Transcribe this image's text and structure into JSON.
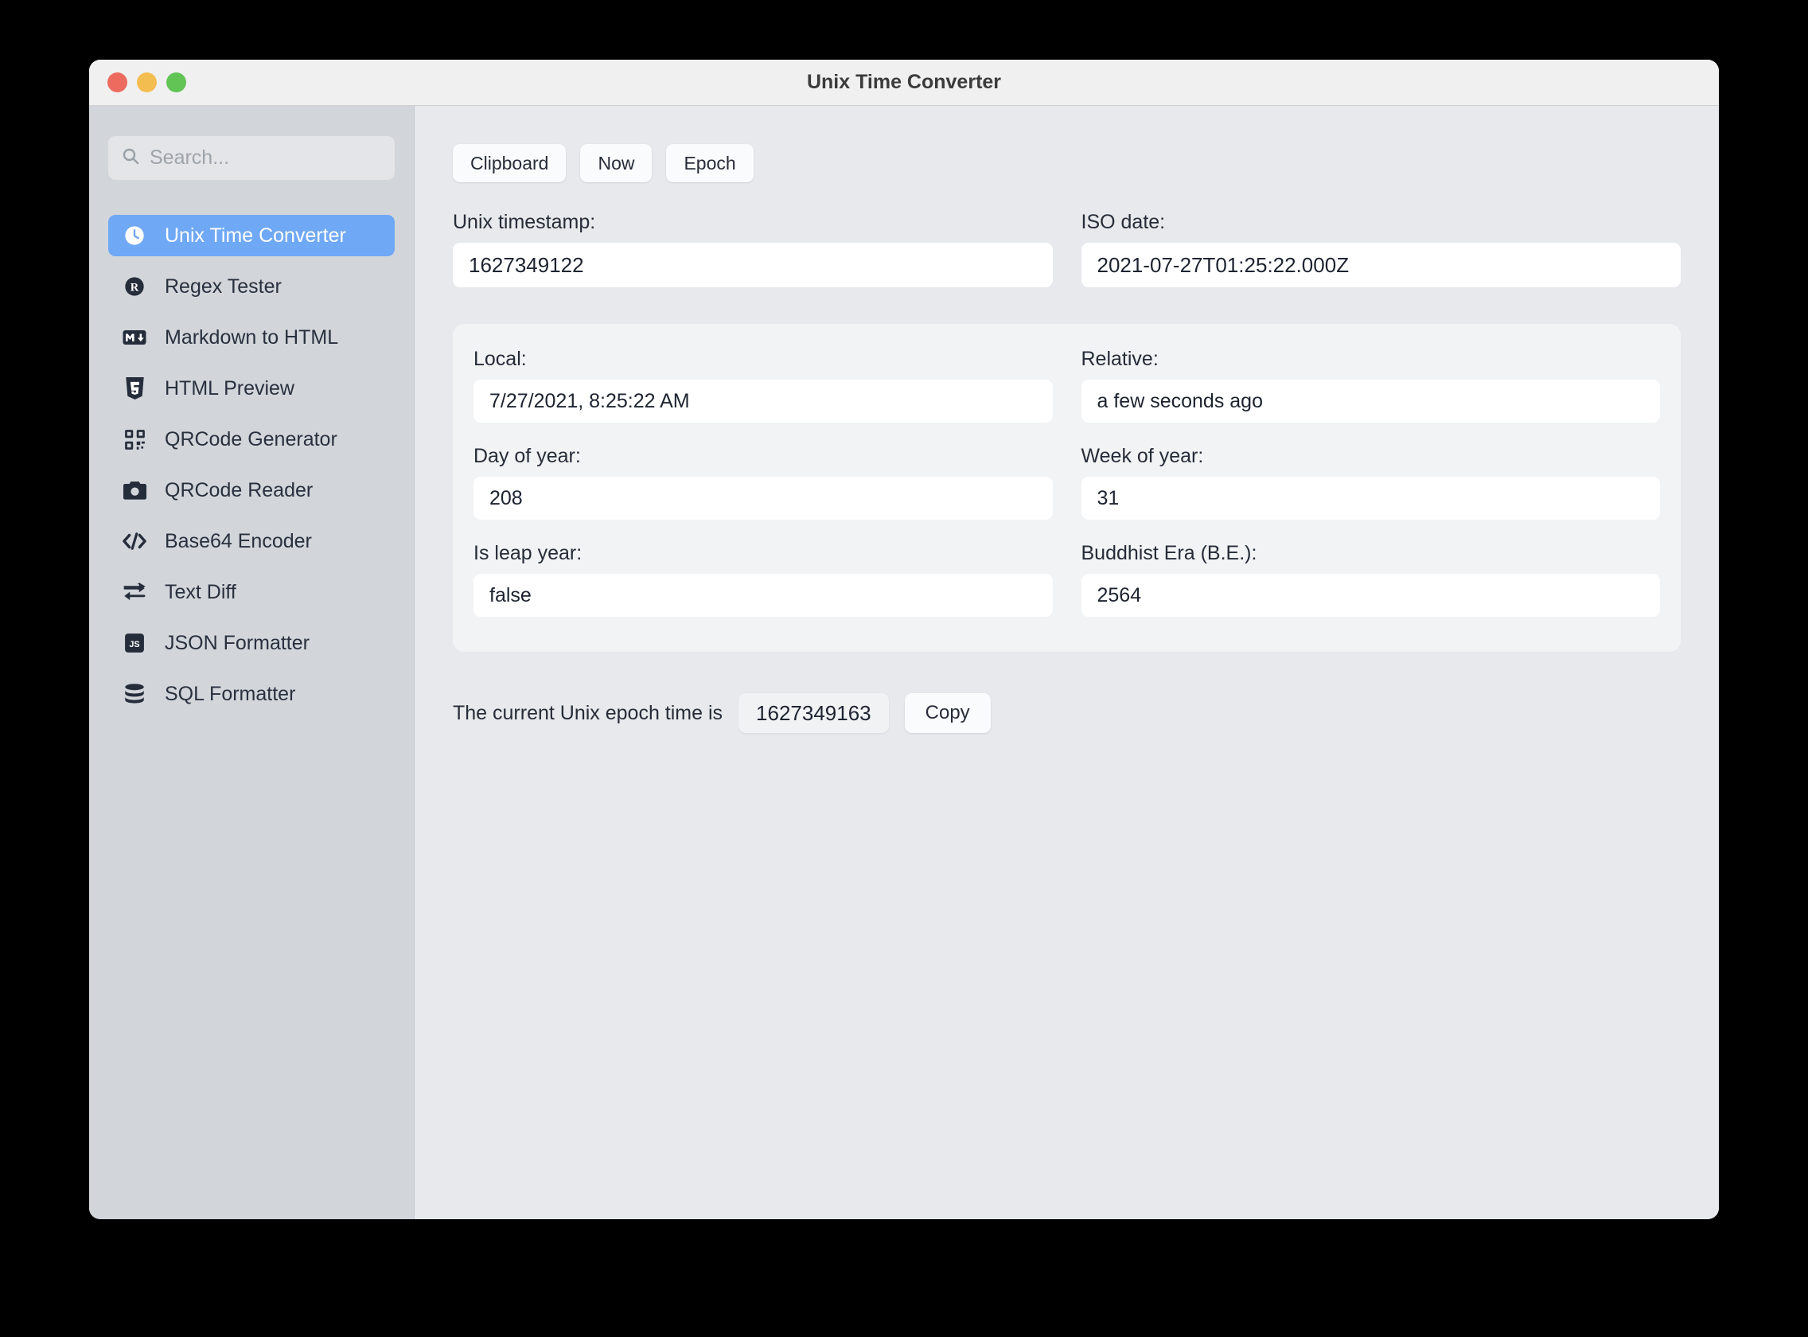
{
  "window": {
    "title": "Unix Time Converter",
    "traffic_lights": [
      {
        "name": "close",
        "color": "#ed6a5f"
      },
      {
        "name": "minimize",
        "color": "#f4bd50"
      },
      {
        "name": "maximize",
        "color": "#61c454"
      }
    ]
  },
  "sidebar": {
    "search": {
      "placeholder": "Search...",
      "value": "",
      "icon": "search-icon"
    },
    "items": [
      {
        "label": "Unix Time Converter",
        "icon": "clock-icon",
        "active": true
      },
      {
        "label": "Regex Tester",
        "icon": "regex-circle-icon",
        "active": false
      },
      {
        "label": "Markdown to HTML",
        "icon": "markdown-icon",
        "active": false
      },
      {
        "label": "HTML Preview",
        "icon": "html5-icon",
        "active": false
      },
      {
        "label": "QRCode Generator",
        "icon": "qrcode-icon",
        "active": false
      },
      {
        "label": "QRCode Reader",
        "icon": "camera-icon",
        "active": false
      },
      {
        "label": "Base64 Encoder",
        "icon": "code-brackets-icon",
        "active": false
      },
      {
        "label": "Text Diff",
        "icon": "exchange-arrows-icon",
        "active": false
      },
      {
        "label": "JSON Formatter",
        "icon": "js-badge-icon",
        "active": false
      },
      {
        "label": "SQL Formatter",
        "icon": "database-icon",
        "active": false
      }
    ],
    "accent_color": "#6fa8f5",
    "background_color": "#d2d6db"
  },
  "main": {
    "toolbar": {
      "clipboard_label": "Clipboard",
      "now_label": "Now",
      "epoch_label": "Epoch"
    },
    "top_fields": {
      "timestamp_label": "Unix timestamp:",
      "timestamp_value": "1627349122",
      "iso_label": "ISO date:",
      "iso_value": "2021-07-27T01:25:22.000Z"
    },
    "details": {
      "local_label": "Local:",
      "local_value": "7/27/2021, 8:25:22 AM",
      "relative_label": "Relative:",
      "relative_value": "a few seconds ago",
      "day_of_year_label": "Day of year:",
      "day_of_year_value": "208",
      "week_of_year_label": "Week of year:",
      "week_of_year_value": "31",
      "leap_year_label": "Is leap year:",
      "leap_year_value": "false",
      "buddhist_label": "Buddhist Era (B.E.):",
      "buddhist_value": "2564"
    },
    "footer": {
      "epoch_text": "The current Unix epoch time is",
      "epoch_value": "1627349163",
      "copy_label": "Copy"
    }
  }
}
